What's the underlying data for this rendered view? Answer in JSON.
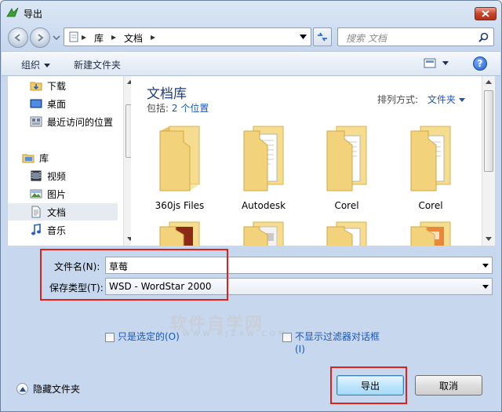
{
  "window": {
    "title": "导出",
    "close_symbol": "✕"
  },
  "address_bar": {
    "breadcrumbs": [
      "库",
      "文档"
    ],
    "separator": "▸"
  },
  "search": {
    "placeholder": "搜索 文档"
  },
  "toolbar": {
    "organize_label": "组织",
    "new_folder_label": "新建文件夹",
    "help_symbol": "?"
  },
  "nav_pane": {
    "items": [
      {
        "label": "下载",
        "icon": "download-folder-icon"
      },
      {
        "label": "桌面",
        "icon": "desktop-icon"
      },
      {
        "label": "最近访问的位置",
        "icon": "recent-places-icon"
      },
      {
        "label": "库",
        "icon": "libraries-icon"
      },
      {
        "label": "视频",
        "icon": "videos-icon"
      },
      {
        "label": "图片",
        "icon": "pictures-icon"
      },
      {
        "label": "文档",
        "icon": "documents-icon",
        "selected": true
      },
      {
        "label": "音乐",
        "icon": "music-icon"
      }
    ]
  },
  "main": {
    "library_title": "文档库",
    "includes_prefix": "包括:",
    "includes_link": "2 个位置",
    "arrange_label": "排列方式:",
    "arrange_value": "文件夹",
    "folders": [
      {
        "label": "360js Files"
      },
      {
        "label": "Autodesk"
      },
      {
        "label": "Corel"
      },
      {
        "label": "Corel"
      }
    ]
  },
  "form": {
    "filename_label": "文件名(N):",
    "filename_value": "草莓",
    "filetype_label": "保存类型(T):",
    "filetype_value": "WSD - WordStar 2000",
    "checkbox_selected_only": "只是选定的(O)",
    "checkbox_no_filter_dialog_line1": "不显示过滤器对话框",
    "checkbox_no_filter_dialog_line2": "(I)"
  },
  "watermark": {
    "text": "软件自学网",
    "sub": "WWW.RJZXW.COM"
  },
  "footer": {
    "hide_folders_label": "隐藏文件夹",
    "export_button": "导出",
    "cancel_button": "取消"
  },
  "colors": {
    "accent": "#1a56b8",
    "highlight_box": "#e0201c",
    "folder": "#f2d37c"
  }
}
